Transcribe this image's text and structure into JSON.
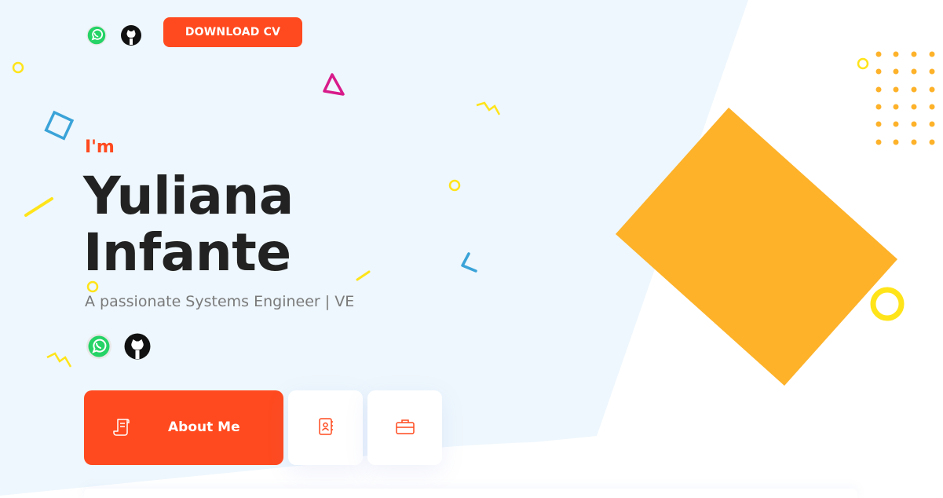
{
  "colors": {
    "accent": "#ff4a1f",
    "background_panel": "#eef7fd",
    "diamond": "#fdb22a",
    "text_dark": "#222222",
    "text_muted": "#7a7a7a"
  },
  "header": {
    "icons": [
      "whatsapp-icon",
      "github-icon"
    ],
    "download_cv_label": "DOWNLOAD CV"
  },
  "hero": {
    "intro": "I'm",
    "first_name": "Yuliana",
    "last_name": "Infante",
    "tagline": "A passionate Systems Engineer | VE",
    "social_icons": [
      "whatsapp-icon",
      "github-icon"
    ]
  },
  "tabs": [
    {
      "label": "About Me",
      "icon": "resume-scroll-icon",
      "active": true
    },
    {
      "label": "",
      "icon": "contact-book-icon",
      "active": false
    },
    {
      "label": "",
      "icon": "briefcase-icon",
      "active": false
    }
  ]
}
